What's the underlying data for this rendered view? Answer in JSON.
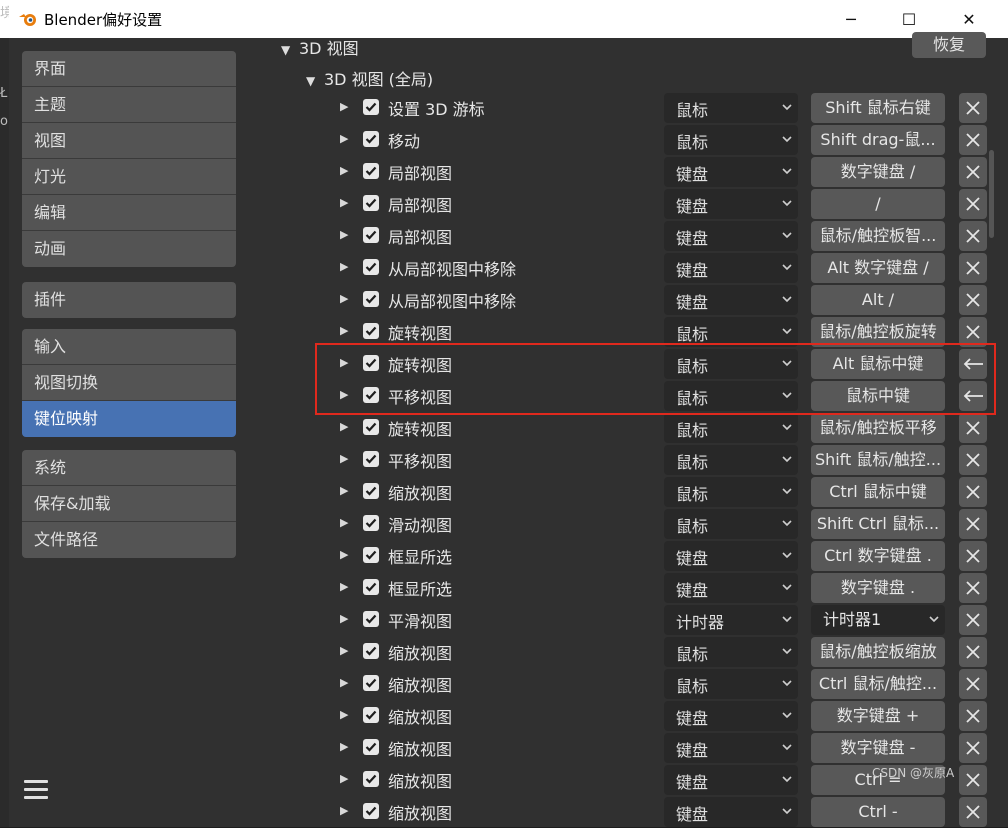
{
  "window": {
    "title": "Blender偏好设置",
    "controls": {
      "minimize": "─",
      "maximize": "☐",
      "close": "✕"
    }
  },
  "left_edge_fragments": [
    "境",
    "Ł",
    "ol"
  ],
  "sidebar": {
    "groups": [
      [
        "界面",
        "主题",
        "视图",
        "灯光",
        "编辑",
        "动画"
      ],
      [
        "插件"
      ],
      [
        "输入",
        "视图切换",
        "键位映射"
      ],
      [
        "系统",
        "保存&加载",
        "文件路径"
      ]
    ],
    "active": "键位映射"
  },
  "content": {
    "section": "3D 视图",
    "subsection": "3D 视图 (全局)",
    "restore_button": "恢复",
    "rows": [
      {
        "name": "设置 3D 游标",
        "type": "鼠标",
        "key": "Shift 鼠标右键",
        "action": "remove"
      },
      {
        "name": "移动",
        "type": "鼠标",
        "key": "Shift drag-鼠...",
        "action": "remove"
      },
      {
        "name": "局部视图",
        "type": "键盘",
        "key": "数字键盘 /",
        "action": "remove"
      },
      {
        "name": "局部视图",
        "type": "键盘",
        "key": "/",
        "action": "remove"
      },
      {
        "name": "局部视图",
        "type": "键盘",
        "key": "鼠标/触控板智...",
        "action": "remove"
      },
      {
        "name": "从局部视图中移除",
        "type": "键盘",
        "key": "Alt 数字键盘 /",
        "action": "remove"
      },
      {
        "name": "从局部视图中移除",
        "type": "键盘",
        "key": "Alt /",
        "action": "remove"
      },
      {
        "name": "旋转视图",
        "type": "鼠标",
        "key": "鼠标/触控板旋转",
        "action": "remove"
      },
      {
        "name": "旋转视图",
        "type": "鼠标",
        "key": "Alt 鼠标中键",
        "action": "restore"
      },
      {
        "name": "平移视图",
        "type": "鼠标",
        "key": "鼠标中键",
        "action": "restore"
      },
      {
        "name": "旋转视图",
        "type": "鼠标",
        "key": "鼠标/触控板平移",
        "action": "remove"
      },
      {
        "name": "平移视图",
        "type": "鼠标",
        "key": "Shift 鼠标/触控...",
        "action": "remove"
      },
      {
        "name": "缩放视图",
        "type": "鼠标",
        "key": "Ctrl 鼠标中键",
        "action": "remove"
      },
      {
        "name": "滑动视图",
        "type": "鼠标",
        "key": "Shift Ctrl 鼠标...",
        "action": "remove"
      },
      {
        "name": "框显所选",
        "type": "键盘",
        "key": "Ctrl 数字键盘 .",
        "action": "remove"
      },
      {
        "name": "框显所选",
        "type": "键盘",
        "key": "数字键盘 .",
        "action": "remove"
      },
      {
        "name": "平滑视图",
        "type": "计时器",
        "key": "计时器1",
        "key_dropdown": true,
        "action": "remove"
      },
      {
        "name": "缩放视图",
        "type": "鼠标",
        "key": "鼠标/触控板缩放",
        "action": "remove"
      },
      {
        "name": "缩放视图",
        "type": "鼠标",
        "key": "Ctrl 鼠标/触控...",
        "action": "remove"
      },
      {
        "name": "缩放视图",
        "type": "键盘",
        "key": "数字键盘 +",
        "action": "remove"
      },
      {
        "name": "缩放视图",
        "type": "键盘",
        "key": "数字键盘 -",
        "action": "remove"
      },
      {
        "name": "缩放视图",
        "type": "键盘",
        "key": "Ctrl =",
        "action": "remove"
      },
      {
        "name": "缩放视图",
        "type": "键盘",
        "key": "Ctrl -",
        "action": "remove"
      }
    ]
  },
  "watermark": "CSDN @灰原A",
  "colors": {
    "active_nav": "#4772b3",
    "highlight_box": "#e0291d",
    "panel_bg": "#303030"
  }
}
